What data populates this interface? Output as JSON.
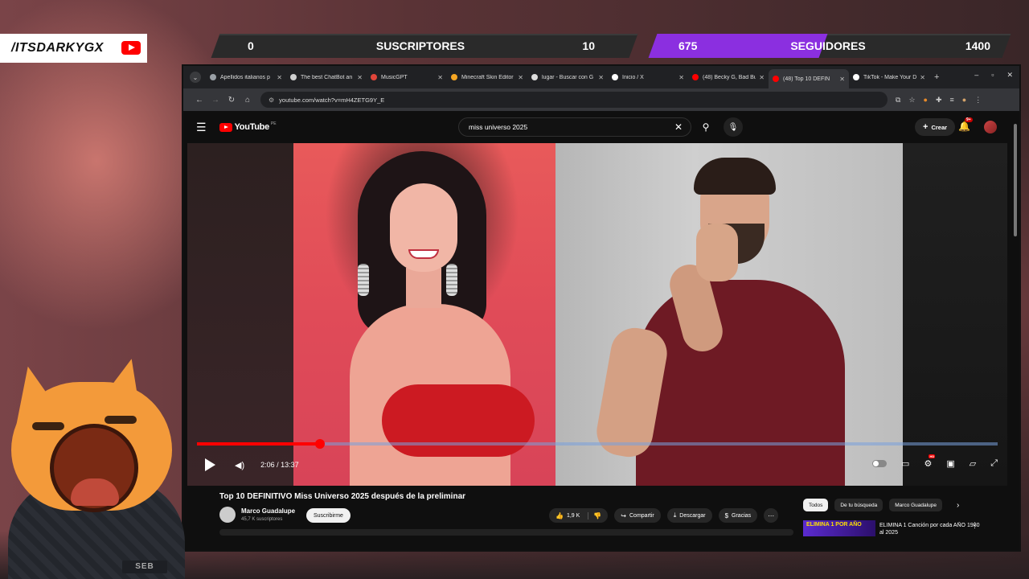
{
  "overlay": {
    "handle": "/ITSDARKYGX",
    "subs_current": "0",
    "subs_label": "SUSCRIPTORES",
    "subs_goal": "10",
    "followers_current": "675",
    "followers_label": "SEGUIDORES",
    "followers_goal": "1400",
    "followers_progress": 0.482,
    "mascot_tag": "SEB",
    "colors": {
      "accent": "#8b2fe0",
      "youtube_red": "#ff0000"
    }
  },
  "browser": {
    "tabs": [
      {
        "label": "Apellidos italianos p",
        "favicon": "globe-icon",
        "color": "#9aa0a6",
        "active": false
      },
      {
        "label": "The best ChatBot an",
        "favicon": "chatbot-icon",
        "color": "#cfcfcf",
        "active": false
      },
      {
        "label": "MusicGPT",
        "favicon": "musicgpt-icon",
        "color": "#e0453a",
        "active": false
      },
      {
        "label": "Minecraft Skin Editor",
        "favicon": "minecraft-icon",
        "color": "#f5a623",
        "active": false
      },
      {
        "label": "lugar - Buscar con G",
        "favicon": "google-icon",
        "color": "#dddddd",
        "active": false
      },
      {
        "label": "Inicio / X",
        "favicon": "x-icon",
        "color": "#ffffff",
        "active": false
      },
      {
        "label": "(48) Becky G, Bad Bu",
        "favicon": "youtube-icon",
        "color": "#ff0000",
        "active": false
      },
      {
        "label": "(48) Top 10 DEFIN",
        "favicon": "youtube-icon",
        "color": "#ff0000",
        "active": true
      },
      {
        "label": "TikTok - Make Your D",
        "favicon": "tiktok-icon",
        "color": "#ffffff",
        "active": false
      }
    ],
    "url": "youtube.com/watch?v=mH4ZETG9Y_E"
  },
  "youtube": {
    "logo_text": "YouTube",
    "region": "PE",
    "search_value": "miss universo 2025",
    "create_label": "Crear",
    "notifications_count": "9+",
    "player": {
      "time": "2:06 / 13:37",
      "progress": 0.154,
      "hd_label": "HD"
    },
    "video_title": "Top 10 DEFINITIVO Miss Universo 2025 después de la preliminar",
    "channel": {
      "name": "Marco Guadalupe",
      "subscribers": "45,7 K suscriptores",
      "subscribe_label": "Suscribirme"
    },
    "actions": {
      "likes": "1,9 K",
      "share": "Compartir",
      "download": "Descargar",
      "thanks": "Gracias"
    },
    "chips": [
      "Todos",
      "De tu búsqueda",
      "Marco Guadalupe"
    ],
    "recommendation": {
      "thumb_text": "ELIMINA 1 POR AÑO",
      "title": "ELIMINA 1 Canción por cada AÑO 1980 al 2025"
    }
  }
}
